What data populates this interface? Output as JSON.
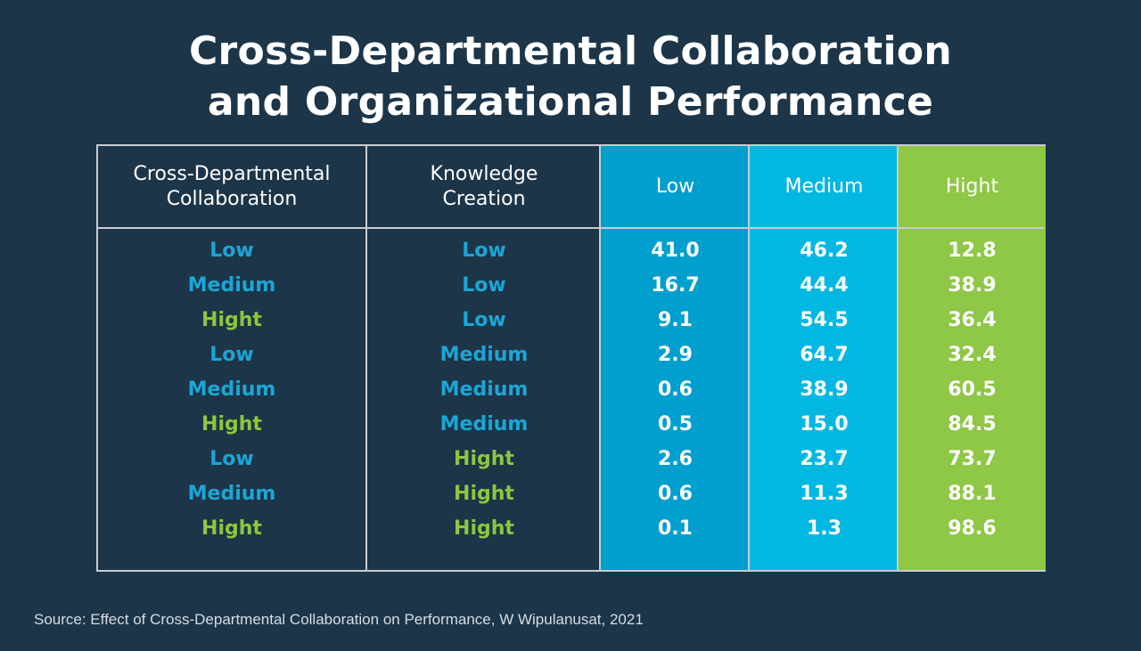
{
  "title_line1": "Cross-Departmental Collaboration",
  "title_line2": "and Organizational Performance",
  "source": "Source: Effect of Cross-Departmental Collaboration on Performance, W Wipulanusat, 2021",
  "colors": {
    "background": "#1c3549",
    "low_column": "#019fce",
    "medium_column": "#02b8e2",
    "high_column": "#8fc746",
    "low_medium_text": "#1ba6d6",
    "high_text": "#8dc63f"
  },
  "chart_data": {
    "type": "table",
    "title": "Cross-Departmental Collaboration and Organizational Performance",
    "columns": [
      "Cross-Departmental Collaboration",
      "Knowledge Creation",
      "Low",
      "Medium",
      "Hight"
    ],
    "rows": [
      {
        "collaboration": "Low",
        "knowledge": "Low",
        "low": "41.0",
        "medium": "46.2",
        "high": "12.8"
      },
      {
        "collaboration": "Medium",
        "knowledge": "Low",
        "low": "16.7",
        "medium": "44.4",
        "high": "38.9"
      },
      {
        "collaboration": "Hight",
        "knowledge": "Low",
        "low": "9.1",
        "medium": "54.5",
        "high": "36.4"
      },
      {
        "collaboration": "Low",
        "knowledge": "Medium",
        "low": "2.9",
        "medium": "64.7",
        "high": "32.4"
      },
      {
        "collaboration": "Medium",
        "knowledge": "Medium",
        "low": "0.6",
        "medium": "38.9",
        "high": "60.5"
      },
      {
        "collaboration": "Hight",
        "knowledge": "Medium",
        "low": "0.5",
        "medium": "15.0",
        "high": "84.5"
      },
      {
        "collaboration": "Low",
        "knowledge": "Hight",
        "low": "2.6",
        "medium": "23.7",
        "high": "73.7"
      },
      {
        "collaboration": "Medium",
        "knowledge": "Hight",
        "low": "0.6",
        "medium": "11.3",
        "high": "88.1"
      },
      {
        "collaboration": "Hight",
        "knowledge": "Hight",
        "low": "0.1",
        "medium": "1.3",
        "high": "98.6"
      }
    ],
    "source": "Effect of Cross-Departmental Collaboration on Performance, W Wipulanusat, 2021"
  }
}
